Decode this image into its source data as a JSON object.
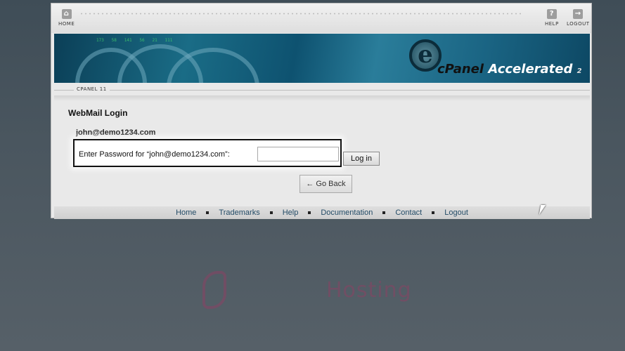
{
  "toolbar": {
    "home_label": "HOME",
    "help_label": "HELP",
    "logout_label": "LOGOUT"
  },
  "banner": {
    "brand_cpanel": "cPanel",
    "brand_accelerated": "Accelerated",
    "brand_version": "2"
  },
  "breadcrumb": "CPANEL 11",
  "page": {
    "title": "WebMail Login",
    "account": "john@demo1234.com",
    "password_label": "Enter Password for “john@demo1234.com”:",
    "password_value": "",
    "login_button": "Log in",
    "back_button": "← Go Back"
  },
  "footer": {
    "links": [
      "Home",
      "Trademarks",
      "Help",
      "Documentation",
      "Contact",
      "Logout"
    ]
  },
  "watermark": {
    "text": "Hosting"
  },
  "colors": {
    "accent_link": "#234b66",
    "banner": "#1a6c86"
  }
}
